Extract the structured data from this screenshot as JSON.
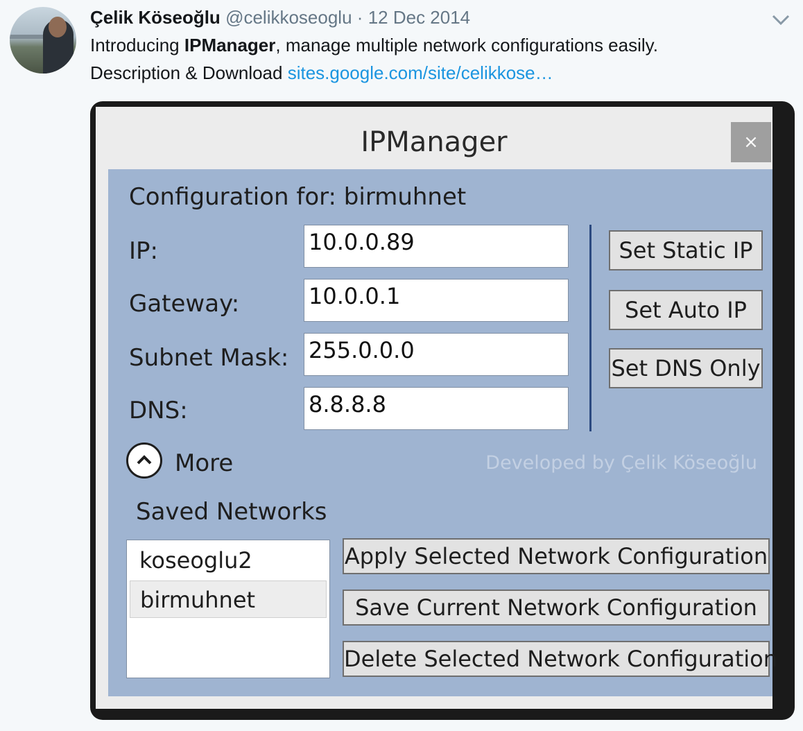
{
  "tweet": {
    "author_name": "Çelik Köseoğlu",
    "handle": "@celikkoseoglu",
    "separator": "·",
    "date": "12 Dec 2014",
    "text_prefix": "Introducing ",
    "text_bold": "IPManager",
    "text_suffix": ", manage multiple network configurations easily.",
    "line2_text": "Description & Download ",
    "link_text": "sites.google.com/site/celikkose…",
    "link_color": "#1b95e0",
    "menu_icon": "chevron-down-icon"
  },
  "app": {
    "title": "IPManager",
    "close_symbol": "×",
    "config_title": "Configuration for: birmuhnet",
    "fields": [
      {
        "label": "IP:",
        "value": "10.0.0.89"
      },
      {
        "label": "Gateway:",
        "value": "10.0.0.1"
      },
      {
        "label": "Subnet Mask:",
        "value": "255.0.0.0"
      },
      {
        "label": "DNS:",
        "value": "8.8.8.8"
      }
    ],
    "side_buttons": [
      "Set Static IP",
      "Set Auto IP",
      "Set DNS Only"
    ],
    "more_label": "More",
    "more_icon": "chevron-up-circle-icon",
    "credit": "Developed by Çelik Köseoğlu",
    "saved_title": "Saved Networks",
    "saved_networks": [
      {
        "name": "koseoglu2",
        "selected": false
      },
      {
        "name": "birmuhnet",
        "selected": true
      }
    ],
    "actions": [
      "Apply Selected Network Configuration",
      "Save Current Network Configuration",
      "Delete Selected Network Configuration"
    ],
    "colors": {
      "panel": "#9fb4d1",
      "divider": "#2c4a80",
      "window": "#ececec"
    }
  }
}
